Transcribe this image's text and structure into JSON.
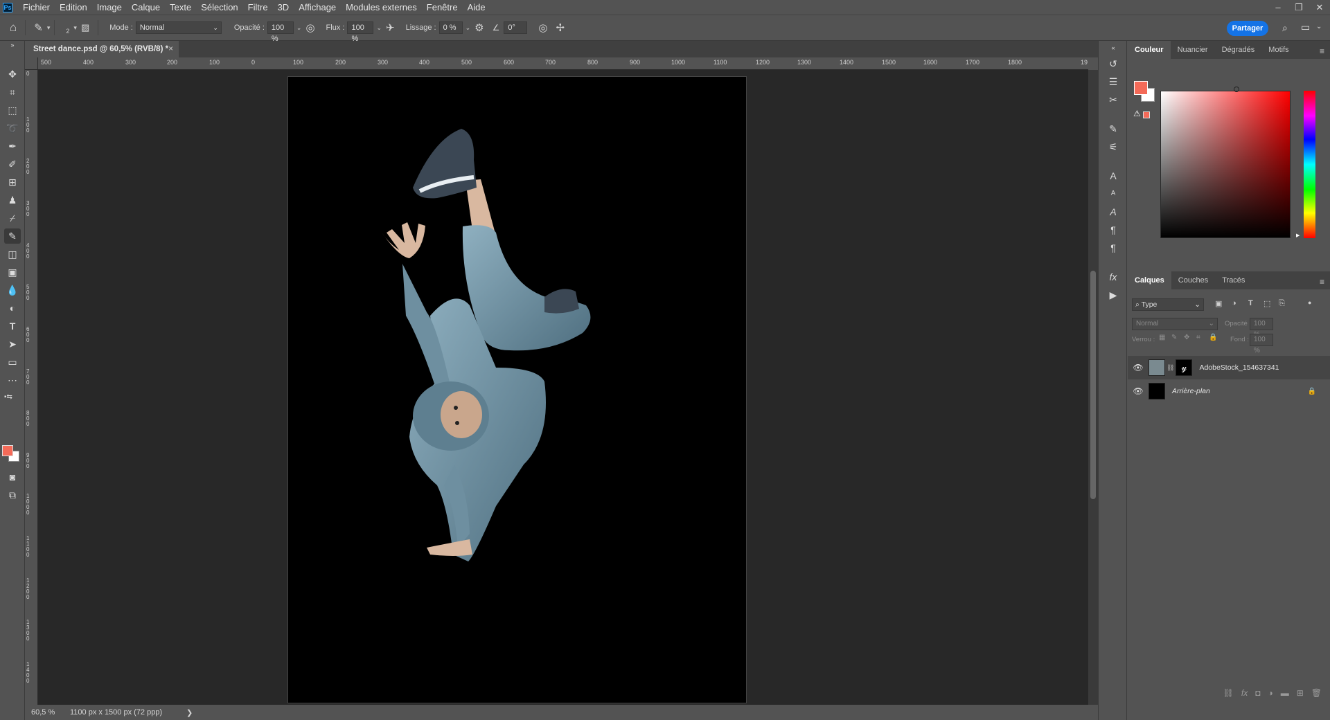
{
  "app": {
    "logo": "Ps"
  },
  "menu": [
    "Fichier",
    "Edition",
    "Image",
    "Calque",
    "Texte",
    "Sélection",
    "Filtre",
    "3D",
    "Affichage",
    "Modules externes",
    "Fenêtre",
    "Aide"
  ],
  "window_controls": {
    "minimize": "‒",
    "restore": "❐",
    "close": "✕"
  },
  "options": {
    "brush_size": "2",
    "mode_label": "Mode :",
    "mode_value": "Normal",
    "opacity_label": "Opacité :",
    "opacity_value": "100 %",
    "flow_label": "Flux :",
    "flow_value": "100 %",
    "smoothing_label": "Lissage :",
    "smoothing_value": "0 %",
    "angle_value": "0°",
    "share_button": "Partager"
  },
  "document_tab": {
    "title": "Street dance.psd @ 60,5% (RVB/8) *",
    "close": "×"
  },
  "ruler_h_labels": [
    "500",
    "400",
    "300",
    "200",
    "100",
    "0",
    "100",
    "200",
    "300",
    "400",
    "500",
    "600",
    "700",
    "800",
    "900",
    "1000",
    "1100",
    "1200",
    "1300",
    "1400",
    "1500",
    "1600",
    "1700",
    "1800",
    "19"
  ],
  "ruler_v_labels": [
    "0",
    "100",
    "200",
    "300",
    "400",
    "500",
    "600",
    "700",
    "800",
    "900",
    "1000",
    "1100",
    "1200",
    "1300",
    "1400"
  ],
  "status": {
    "zoom": "60,5 %",
    "doc_info": "1100 px x 1500 px (72 ppp)",
    "arrow": "❯"
  },
  "color_panel": {
    "tabs": [
      "Couleur",
      "Nuancier",
      "Dégradés",
      "Motifs"
    ],
    "foreground": "#f46a58",
    "background": "#ffffff"
  },
  "layers_panel": {
    "tabs": [
      "Calques",
      "Couches",
      "Tracés"
    ],
    "filter_value": "Type",
    "blend_mode": "Normal",
    "opacity_label": "Opacité :",
    "opacity_value": "100 %",
    "lock_label": "Verrou :",
    "fill_label": "Fond :",
    "fill_value": "100 %",
    "layers": [
      {
        "name": "AdobeStock_154637341",
        "visible": true,
        "selected": true
      },
      {
        "name": "Arrière-plan",
        "visible": true,
        "selected": false,
        "locked": true
      }
    ]
  },
  "colors": {
    "accent": "#1473e6",
    "canvas_bg": "#282828",
    "ui_bg": "#535353"
  }
}
